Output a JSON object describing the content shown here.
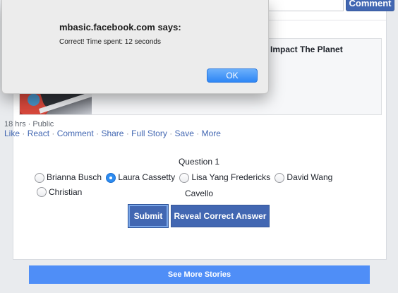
{
  "post": {
    "comment_button": "Comment",
    "comment_placeholder": "",
    "attachment_title": "Impact The Planet",
    "meta": "18 hrs · Public",
    "actions": [
      "Like",
      "React",
      "Comment",
      "Share",
      "Full Story",
      "Save",
      "More"
    ]
  },
  "quiz": {
    "question": "Question 1",
    "options": [
      "Brianna Busch",
      "Laura Cassetty",
      "Lisa Yang Fredericks",
      "David Wang",
      "Christian"
    ],
    "option_continuation": "Cavello",
    "selected_index": 1,
    "submit_label": "Submit",
    "reveal_label": "Reveal Correct Answer"
  },
  "see_more": "See More Stories",
  "dialog": {
    "title": "mbasic.facebook.com says:",
    "message": "Correct! Time spent: 12 seconds",
    "ok_label": "OK"
  },
  "colors": {
    "brand": "#4267b2",
    "link": "#4267b2",
    "see_more_bg": "#4f8ef7",
    "dialog_ok": "#2e86f5",
    "radio_selected": "#2d8cf0"
  }
}
